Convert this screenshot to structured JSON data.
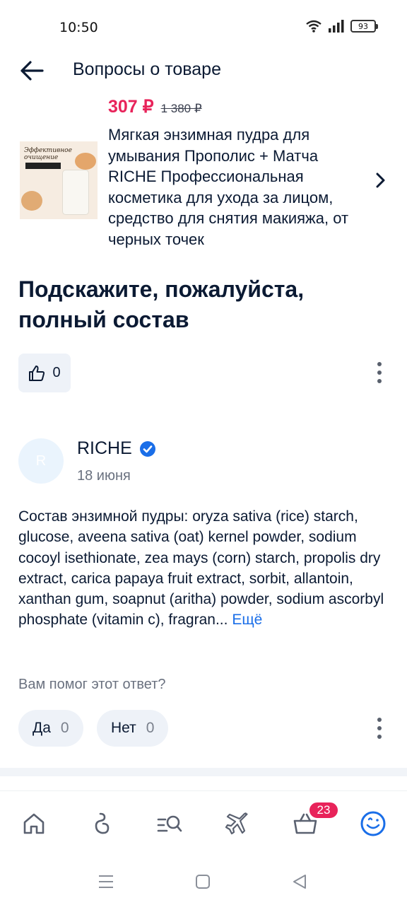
{
  "status_bar": {
    "time": "10:50",
    "battery": "93",
    "icons": [
      "wifi-icon",
      "signal-icon",
      "battery-icon"
    ]
  },
  "header": {
    "title": "Вопросы о товаре",
    "back_icon": "arrow-left-icon"
  },
  "product": {
    "price_current": "307 ₽",
    "price_old": "1 380 ₽",
    "name": "Мягкая энзимная пудра для умывания Прополис + Матча RICHE Профессиональная косметика для ухода за лицом, средство для снятия макияжа, от черных точек",
    "image_text": "Эффективное очищение",
    "arrow_icon": "chevron-right-icon",
    "price_color": "#e8235a"
  },
  "question": {
    "title": "Подскажите, пожалуйста, полный состав",
    "likes": "0"
  },
  "answer": {
    "avatar_letter": "R",
    "author": "RICHE",
    "date": "18 июня",
    "text": "Состав энзимной пудры: oryza sativa (rice) starch, glucose, aveena sativa (oat) kernel powder, sodium cocoyl isethionate, zea mays (corn) starch, propolis dry extract, carica papaya fruit extract, sorbit, allantoin, xanthan gum, soapnut (aritha) powder, sodium ascorbyl phosphate (vitamin c), fragran...",
    "more_label": "Ещё",
    "helpful_question": "Вам помог этот ответ?",
    "yes_label": "Да",
    "yes_count": "0",
    "no_label": "Нет",
    "no_count": "0",
    "link_color": "#1a6ee8"
  },
  "bottom_nav": {
    "items": [
      "home-icon",
      "brand-icon",
      "catalog-search-icon",
      "travel-plane-icon",
      "cart-icon",
      "profile-icon"
    ],
    "cart_badge": "23",
    "active_item": "profile-icon"
  },
  "system_nav": [
    "menu-icon",
    "home-square-icon",
    "back-triangle-icon"
  ]
}
